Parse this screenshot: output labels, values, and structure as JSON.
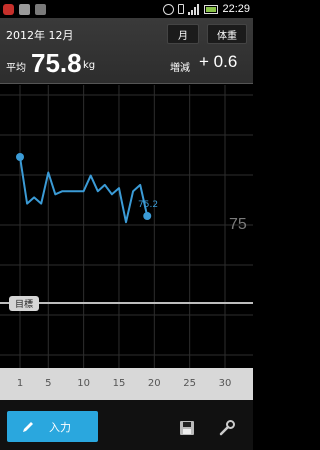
{
  "status_bar": {
    "time": "22:29"
  },
  "header": {
    "date": "2012年 12月",
    "month_button": "月",
    "weight_button": "体重",
    "average_label": "平均",
    "average_value": "75.8",
    "average_unit": "kg",
    "delta_label": "増減",
    "delta_value": "+ 0.6"
  },
  "chart": {
    "goal_label": "目標",
    "ref_label": "75",
    "last_label": "75.2"
  },
  "x_axis": {
    "ticks": [
      "1",
      "5",
      "10",
      "15",
      "20",
      "25",
      "30"
    ]
  },
  "footer": {
    "input_button": "入力"
  },
  "colors": {
    "line": "#3b9bd6",
    "accent": "#2aa7de"
  },
  "chart_data": {
    "type": "line",
    "x": [
      1,
      2,
      3,
      4,
      5,
      6,
      7,
      8,
      9,
      10,
      11,
      12,
      13,
      14,
      15,
      16,
      17,
      18,
      19
    ],
    "values": [
      77.1,
      75.6,
      75.8,
      75.6,
      76.6,
      75.9,
      76.0,
      76.0,
      76.0,
      76.0,
      76.5,
      76.0,
      76.2,
      75.9,
      76.1,
      75.0,
      76.0,
      76.2,
      75.2
    ],
    "xlim": [
      0,
      32
    ],
    "xticks": [
      1,
      5,
      10,
      15,
      20,
      25,
      30
    ],
    "reference_lines": [
      75
    ],
    "goal_line": true,
    "grid": true
  }
}
